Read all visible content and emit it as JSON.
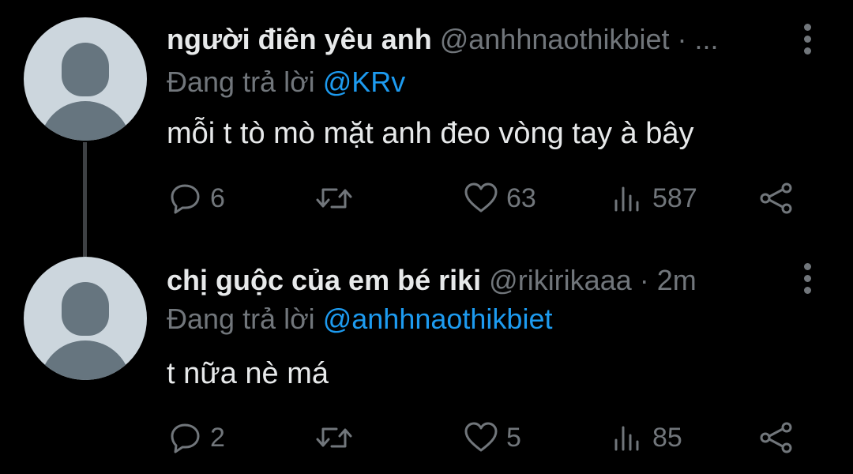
{
  "tweets": [
    {
      "display_name": "người điên yêu anh",
      "handle": "@anhhnaothikbiet",
      "separator": "·",
      "time": "...",
      "reply_prefix": "Đang trả lời",
      "reply_to": "@KRv",
      "text": "mỗi t tò mò mặt anh đeo vòng tay à bây",
      "stats": {
        "replies": "6",
        "retweets": "",
        "likes": "63",
        "views": "587"
      }
    },
    {
      "display_name": "chị guộc của em bé riki",
      "handle": "@rikirikaaa",
      "separator": "·",
      "time": "2m",
      "reply_prefix": "Đang trả lời",
      "reply_to": "@anhhnaothikbiet",
      "text": "t nữa nè má",
      "stats": {
        "replies": "2",
        "retweets": "",
        "likes": "5",
        "views": "85"
      }
    }
  ],
  "icons": {
    "avatar": "default-avatar-icon",
    "more": "more-vertical-icon",
    "reply": "reply-icon",
    "retweet": "retweet-icon",
    "like": "like-icon",
    "views": "views-icon",
    "share": "share-icon"
  },
  "colors": {
    "background": "#000000",
    "text_primary": "#e7e9ea",
    "text_secondary": "#71767b",
    "link": "#1d9bf0",
    "avatar_bg": "#ccd6dd",
    "avatar_fg": "#66757f",
    "thread_line": "#3e4144"
  }
}
